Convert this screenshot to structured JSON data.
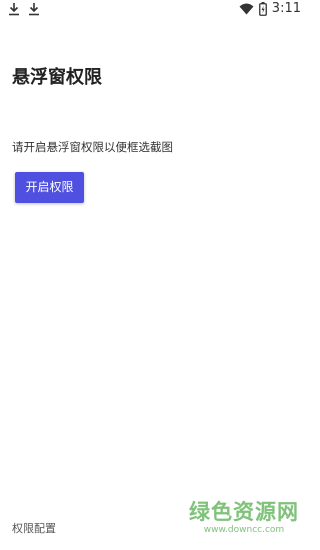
{
  "status_bar": {
    "left_icons": [
      "download-icon",
      "download-icon"
    ],
    "right_icons": [
      "wifi-icon",
      "battery-icon"
    ],
    "time": "3:11"
  },
  "page": {
    "title": "悬浮窗权限",
    "description": "请开启悬浮窗权限以便框选截图",
    "enable_button": "开启权限",
    "footer_link": "权限配置"
  },
  "watermark": {
    "text": "绿色资源网",
    "url": "www.downcc.com",
    "color": "#7fc27a"
  },
  "colors": {
    "accent": "#4f4fe0"
  }
}
